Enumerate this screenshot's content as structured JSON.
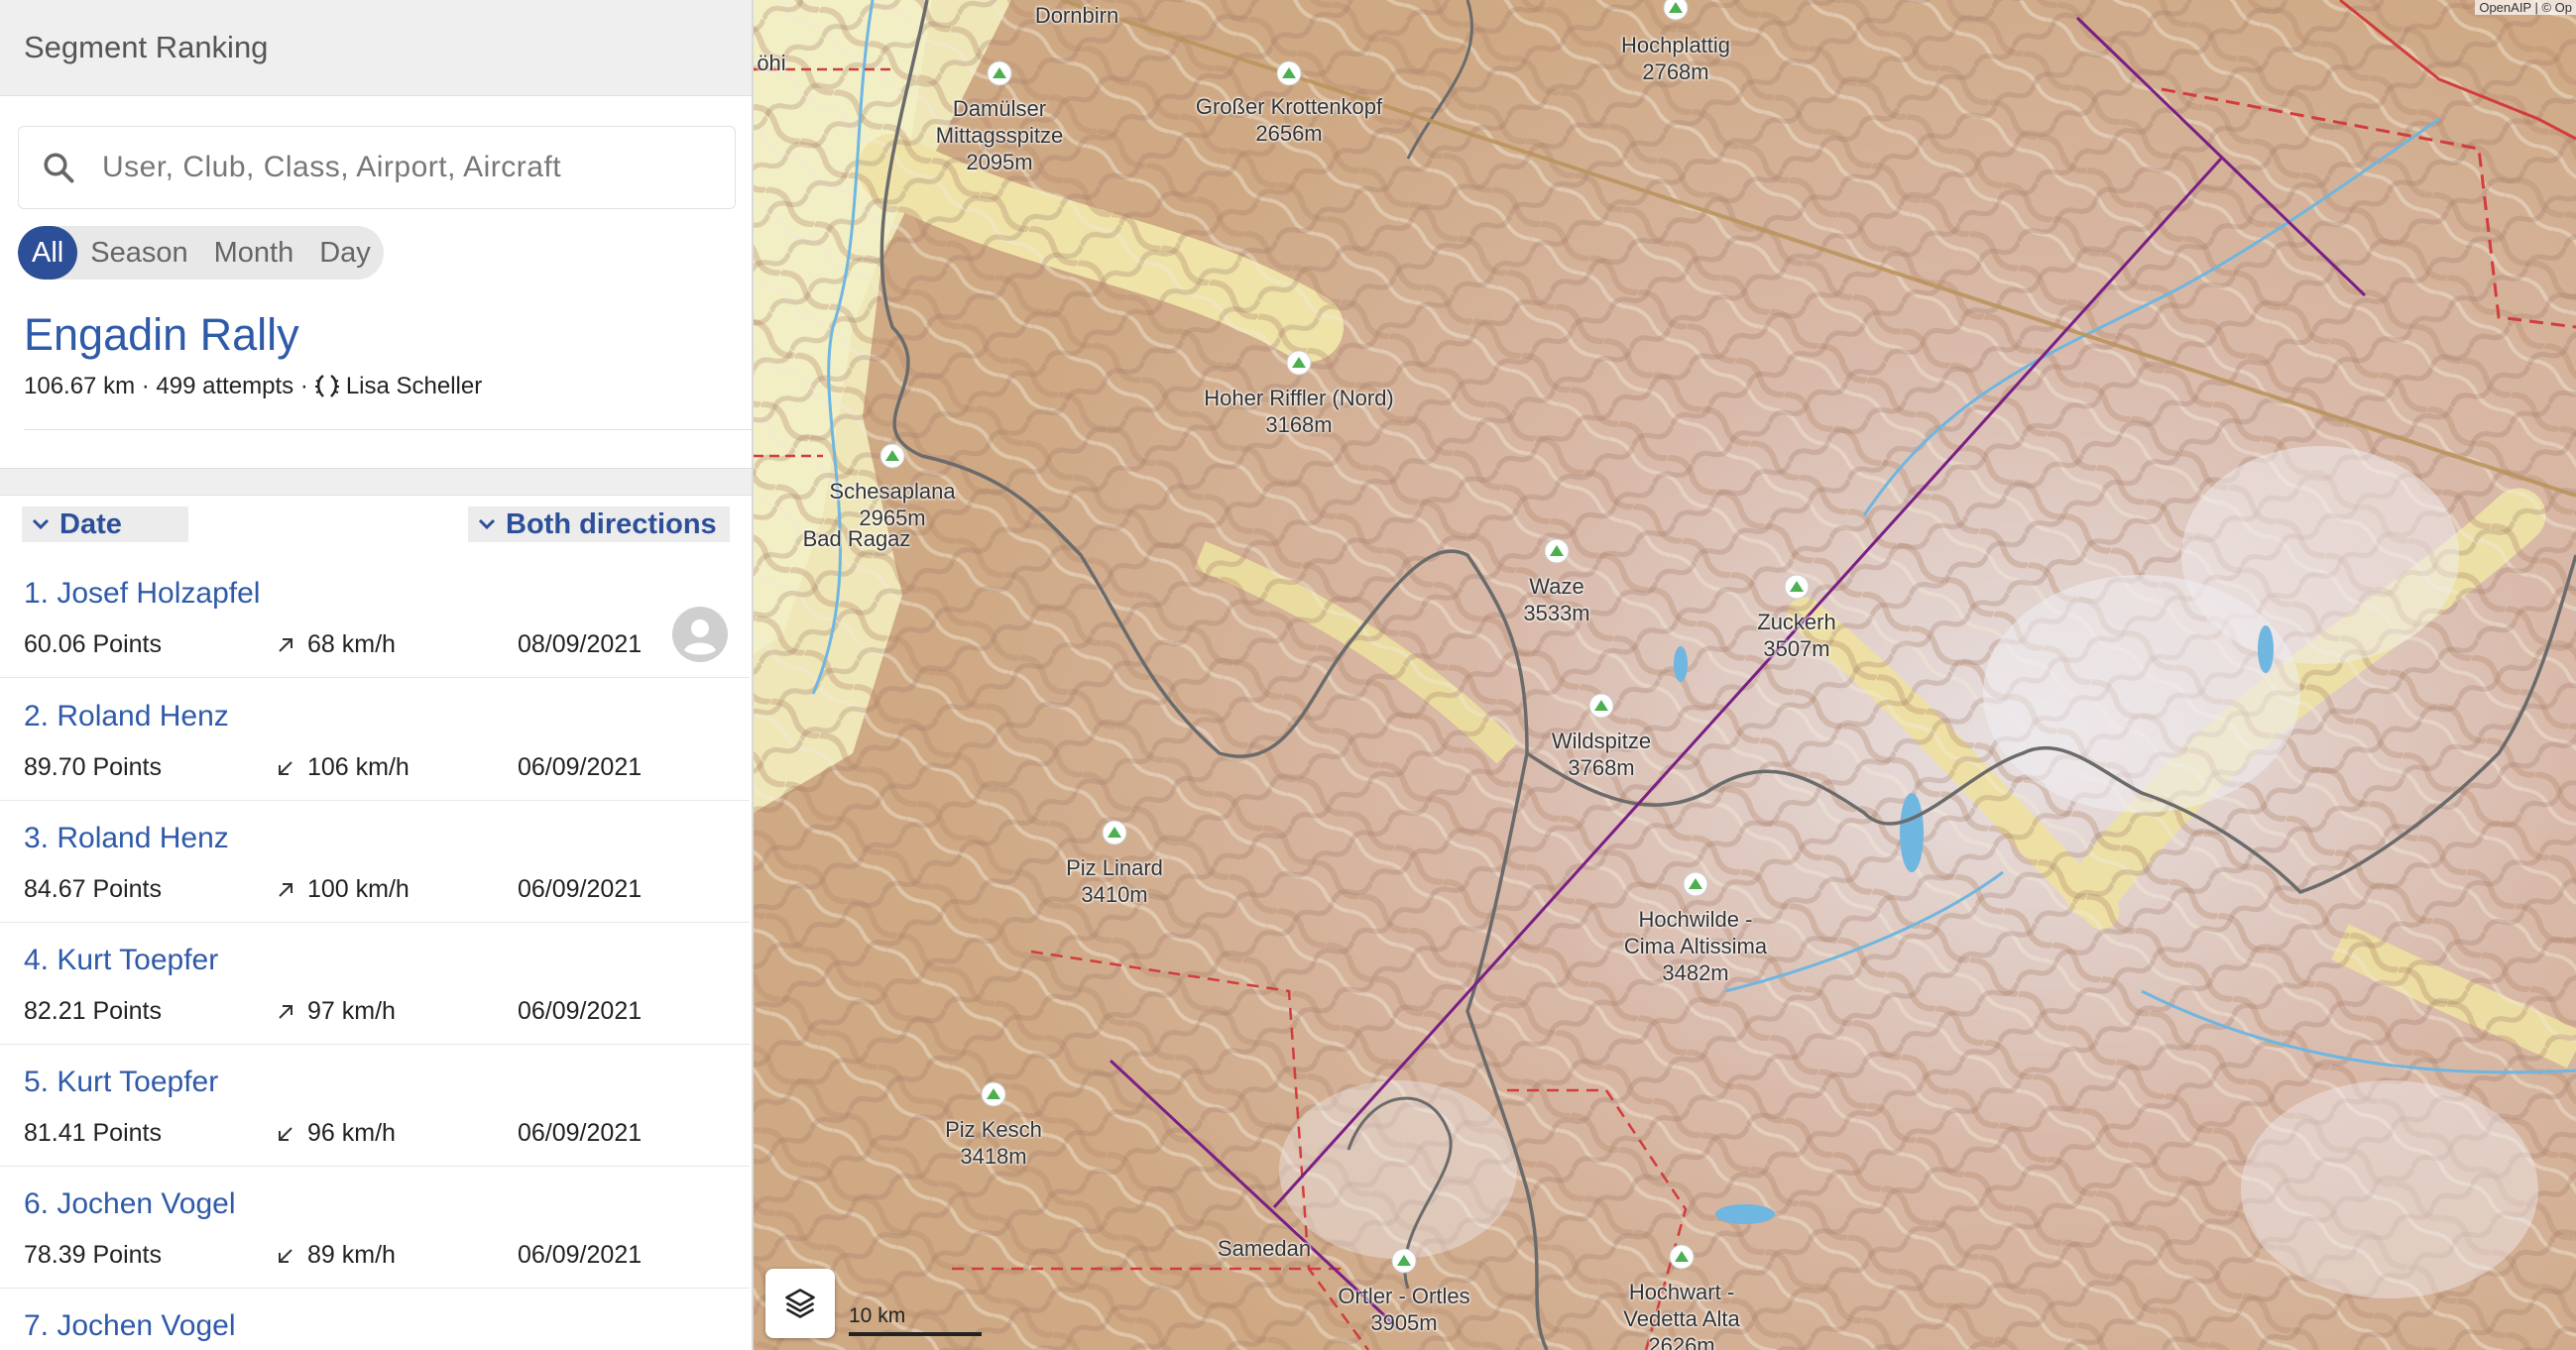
{
  "panel": {
    "header": "Segment Ranking",
    "search_placeholder": "User, Club, Class, Airport, Aircraft",
    "period_tabs": [
      "All",
      "Season",
      "Month",
      "Day"
    ],
    "active_period": "All",
    "segment": {
      "name": "Engadin Rally",
      "meta_left": "106.67 km · 499 attempts ·",
      "record_holder": "Lisa Scheller"
    },
    "filters": {
      "sort_label": "Date",
      "direction_label": "Both directions"
    },
    "rankings": [
      {
        "name": "1. Josef Holzapfel",
        "points": "60.06 Points",
        "speed": "68 km/h",
        "direction": "up-right",
        "date": "08/09/2021",
        "has_avatar": true
      },
      {
        "name": "2. Roland Henz",
        "points": "89.70 Points",
        "speed": "106 km/h",
        "direction": "down-left",
        "date": "06/09/2021"
      },
      {
        "name": "3. Roland Henz",
        "points": "84.67 Points",
        "speed": "100 km/h",
        "direction": "up-right",
        "date": "06/09/2021"
      },
      {
        "name": "4. Kurt Toepfer",
        "points": "82.21 Points",
        "speed": "97 km/h",
        "direction": "up-right",
        "date": "06/09/2021"
      },
      {
        "name": "5. Kurt Toepfer",
        "points": "81.41 Points",
        "speed": "96 km/h",
        "direction": "down-left",
        "date": "06/09/2021"
      },
      {
        "name": "6. Jochen Vogel",
        "points": "78.39 Points",
        "speed": "89 km/h",
        "direction": "down-left",
        "date": "06/09/2021"
      },
      {
        "name": "7. Jochen Vogel",
        "points": "",
        "speed": "",
        "direction": "",
        "date": ""
      }
    ]
  },
  "map": {
    "places": [
      {
        "name": "Dornbirn"
      },
      {
        "name": "öhi"
      },
      {
        "name": "Bad Ragaz"
      },
      {
        "name": "Samedan"
      }
    ],
    "peaks": [
      {
        "name": "Damülser\nMittagsspitze\n2095m"
      },
      {
        "name": "Großer Krottenkopf\n2656m"
      },
      {
        "name": "Hochplattig\n2768m"
      },
      {
        "name": "Hoher Riffler (Nord)\n3168m"
      },
      {
        "name": "Schesaplana\n2965m"
      },
      {
        "name": "Waze\n3533m"
      },
      {
        "name": "Zuckerh\n3507m"
      },
      {
        "name": "Wildspitze\n3768m"
      },
      {
        "name": "Piz Linard\n3410m"
      },
      {
        "name": "Hochwilde -\nCima Altissima\n3482m"
      },
      {
        "name": "Piz Kesch\n3418m"
      },
      {
        "name": "Ortler - Ortles\n3905m"
      },
      {
        "name": "Hochwart -\nVedetta Alta\n2626m"
      }
    ],
    "scale_label": "10 km",
    "attribution": "OpenAIP | © Op",
    "colors": {
      "segment_line": "#7a1f86",
      "border": "#6b6b6b",
      "airspace": "#d23c3c",
      "water": "#6fb6e0"
    }
  }
}
